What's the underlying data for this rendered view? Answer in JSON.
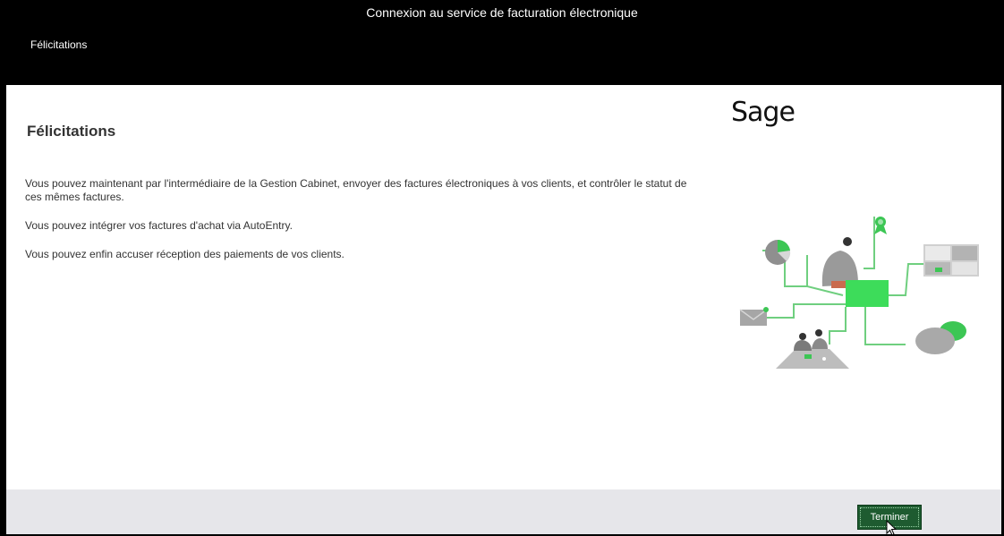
{
  "window": {
    "title": "Connexion au service de facturation électronique"
  },
  "step": {
    "label": "Félicitations"
  },
  "main": {
    "heading": "Félicitations",
    "paragraphs": [
      "Vous pouvez maintenant par l'intermédiaire de la Gestion Cabinet, envoyer des factures électroniques à vos clients, et contrôler le statut de ces mêmes factures.",
      "Vous pouvez intégrer vos factures d'achat via AutoEntry.",
      "Vous pouvez enfin accuser réception des paiements de vos clients."
    ]
  },
  "brand": {
    "logo": "Sage",
    "accent": "#00d639"
  },
  "footer": {
    "finish_label": "Terminer"
  }
}
